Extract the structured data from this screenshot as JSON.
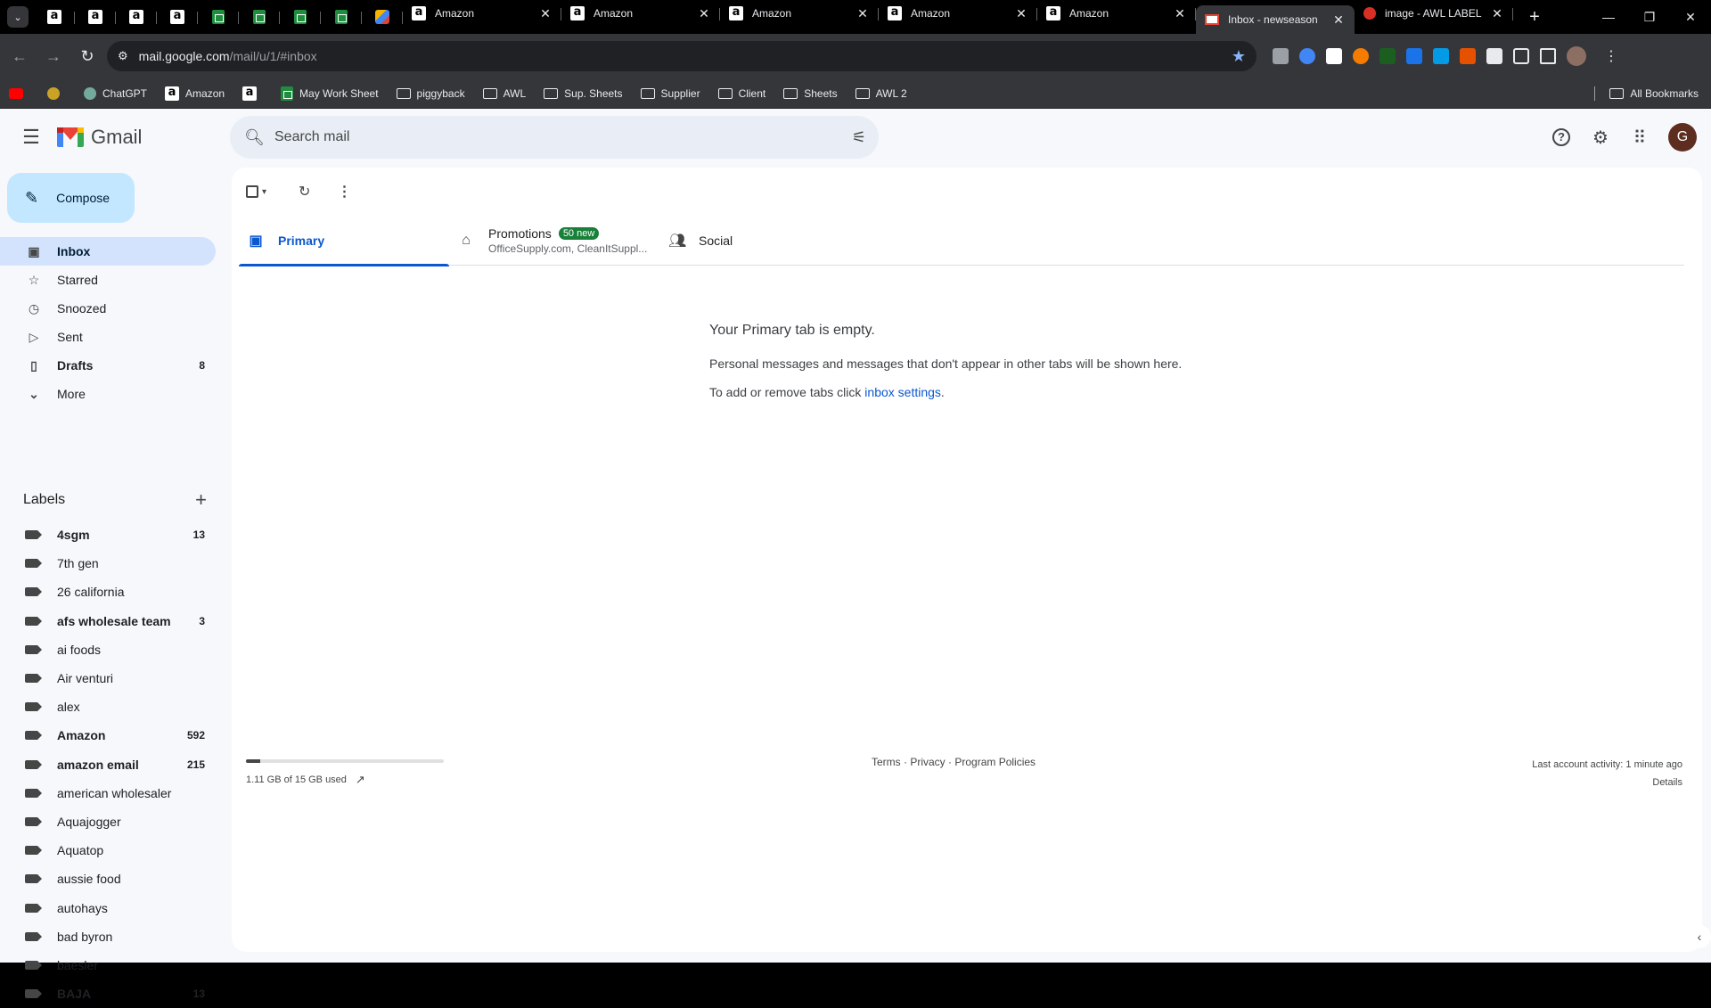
{
  "browser": {
    "pinned_tabs": [
      {
        "icon": "amazon-icon"
      },
      {
        "icon": "amazon-icon"
      },
      {
        "icon": "amazon-icon"
      },
      {
        "icon": "amazon-icon"
      },
      {
        "icon": "sheets-icon"
      },
      {
        "icon": "sheets-icon"
      },
      {
        "icon": "sheets-icon"
      },
      {
        "icon": "sheets-icon"
      },
      {
        "icon": "app-icon"
      }
    ],
    "tabs": [
      {
        "title": "Amazon",
        "icon": "amazon-icon"
      },
      {
        "title": "Amazon",
        "icon": "amazon-icon"
      },
      {
        "title": "Amazon",
        "icon": "amazon-icon"
      },
      {
        "title": "Amazon",
        "icon": "amazon-icon"
      },
      {
        "title": "Amazon",
        "icon": "amazon-icon"
      },
      {
        "title": "Inbox - newseason",
        "icon": "gmail-icon",
        "active": true
      },
      {
        "title": "image - AWL LABEL",
        "icon": "awl-icon"
      }
    ],
    "url_host": "mail.google.com",
    "url_path": "/mail/u/1/#inbox",
    "bookmarks": [
      {
        "label": "",
        "icon": "youtube-icon"
      },
      {
        "label": "",
        "icon": "extension-icon"
      },
      {
        "label": "ChatGPT",
        "icon": "chatgpt-icon"
      },
      {
        "label": "Amazon",
        "icon": "amazon-icon"
      },
      {
        "label": "",
        "icon": "amazon-icon"
      },
      {
        "label": "May Work Sheet",
        "icon": "sheets-icon"
      },
      {
        "label": "piggyback",
        "icon": "folder-icon"
      },
      {
        "label": "AWL",
        "icon": "folder-icon"
      },
      {
        "label": "Sup. Sheets",
        "icon": "folder-icon"
      },
      {
        "label": "Supplier",
        "icon": "folder-icon"
      },
      {
        "label": "Client",
        "icon": "folder-icon"
      },
      {
        "label": "Sheets",
        "icon": "folder-icon"
      },
      {
        "label": "AWL 2",
        "icon": "folder-icon"
      }
    ],
    "all_bookmarks": "All Bookmarks"
  },
  "gmail": {
    "logo_text": "Gmail",
    "search_placeholder": "Search mail",
    "avatar_letter": "G",
    "compose_label": "Compose",
    "nav": [
      {
        "label": "Inbox",
        "icon": "inbox-icon",
        "count": "",
        "active": true
      },
      {
        "label": "Starred",
        "icon": "star-icon",
        "count": ""
      },
      {
        "label": "Snoozed",
        "icon": "clock-icon",
        "count": ""
      },
      {
        "label": "Sent",
        "icon": "send-icon",
        "count": ""
      },
      {
        "label": "Drafts",
        "icon": "draft-icon",
        "count": "8",
        "bold": true
      },
      {
        "label": "More",
        "icon": "chevron-down-icon",
        "count": ""
      }
    ],
    "labels_title": "Labels",
    "labels": [
      {
        "name": "4sgm",
        "count": "13",
        "bold": true
      },
      {
        "name": "7th gen",
        "count": ""
      },
      {
        "name": "26 california",
        "count": ""
      },
      {
        "name": "afs wholesale team",
        "count": "3",
        "bold": true
      },
      {
        "name": "ai foods",
        "count": ""
      },
      {
        "name": "Air venturi",
        "count": ""
      },
      {
        "name": "alex",
        "count": ""
      },
      {
        "name": "Amazon",
        "count": "592",
        "bold": true
      },
      {
        "name": "amazon email",
        "count": "215",
        "bold": true
      },
      {
        "name": "american wholesaler",
        "count": ""
      },
      {
        "name": "Aquajogger",
        "count": ""
      },
      {
        "name": "Aquatop",
        "count": ""
      },
      {
        "name": "aussie food",
        "count": ""
      },
      {
        "name": "autohays",
        "count": ""
      },
      {
        "name": "bad byron",
        "count": ""
      },
      {
        "name": "baesler",
        "count": ""
      },
      {
        "name": "BAJA",
        "count": "13",
        "bold": true
      }
    ],
    "tabs": {
      "primary": "Primary",
      "promotions": "Promotions",
      "promotions_badge": "50 new",
      "promotions_sub": "OfficeSupply.com, CleanItSuppl...",
      "social": "Social"
    },
    "empty": {
      "heading": "Your Primary tab is empty.",
      "line1": "Personal messages and messages that don't appear in other tabs will be shown here.",
      "line2_prefix": "To add or remove tabs click ",
      "line2_link": "inbox settings",
      "line2_suffix": "."
    },
    "storage": {
      "text": "1.11 GB of 15 GB used",
      "fraction": 0.074
    },
    "footer": {
      "terms": "Terms",
      "privacy": "Privacy",
      "policies": "Program Policies",
      "sep": " · ",
      "activity": "Last account activity: 1 minute ago",
      "details": "Details"
    }
  }
}
